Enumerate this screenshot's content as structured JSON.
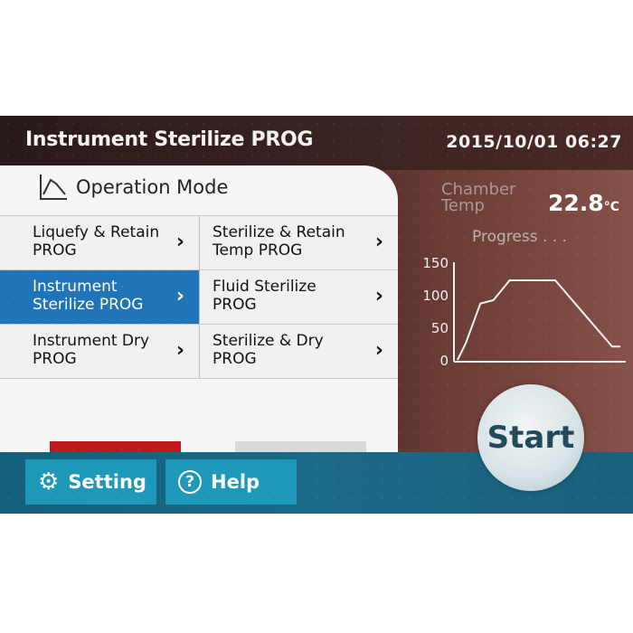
{
  "header": {
    "title": "Instrument Sterilize PROG",
    "datetime": "2015/10/01 06:27"
  },
  "panel": {
    "title": "Operation Mode",
    "title_icon": "graph-icon",
    "programs": [
      {
        "line1": "Liquefy & Retain",
        "line2": "PROG",
        "selected": false
      },
      {
        "line1": "Sterilize & Retain",
        "line2": "Temp PROG",
        "selected": false
      },
      {
        "line1": "Instrument",
        "line2": "Sterilize PROG",
        "selected": true
      },
      {
        "line1": "Fluid Sterilize",
        "line2": "PROG",
        "selected": false
      },
      {
        "line1": "Instrument Dry",
        "line2": "PROG",
        "selected": false
      },
      {
        "line1": "Sterilize & Dry",
        "line2": "PROG",
        "selected": false
      }
    ],
    "chevron": "›",
    "cancel_icon": "✕",
    "confirm_icon": "✓",
    "confirm_enabled": false
  },
  "status": {
    "chamber_label_1": "Chamber",
    "chamber_label_2": "Temp",
    "chamber_value": "22.8",
    "chamber_unit": "°C",
    "progress_label": "Progress . . .",
    "y_ticks": [
      "150",
      "100",
      "50",
      "0"
    ]
  },
  "progress_profile": {
    "type": "line",
    "y": [
      0,
      25,
      85,
      90,
      120,
      120,
      120,
      20,
      20
    ],
    "ylim": [
      0,
      150
    ]
  },
  "footer": {
    "setting_label": "Setting",
    "help_label": "Help",
    "start_label": "Start"
  },
  "colors": {
    "selected": "#1f75b8",
    "cancel": "#c0161d",
    "footer_button": "#1d98b8"
  }
}
